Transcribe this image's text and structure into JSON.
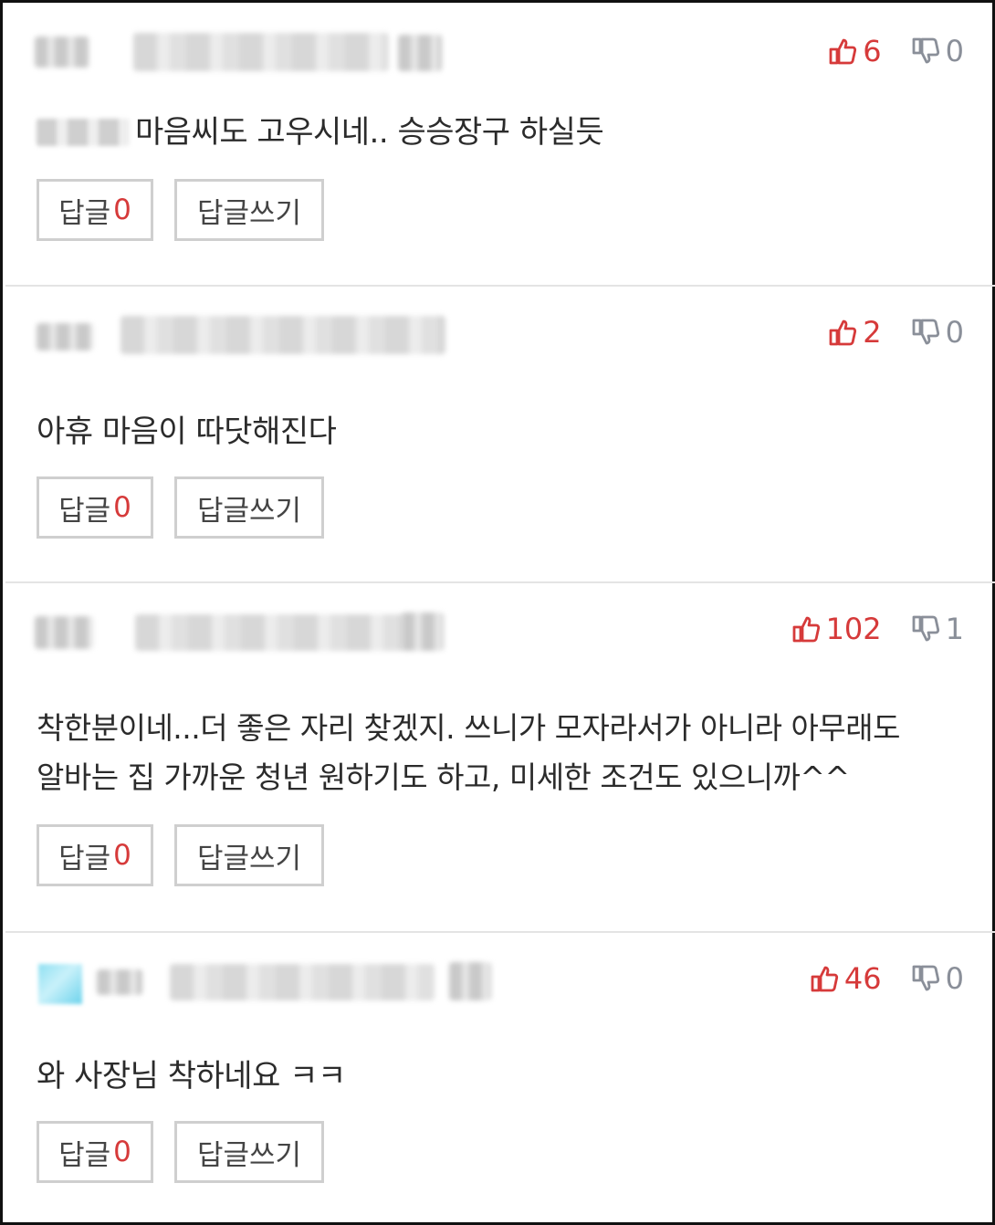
{
  "comments": [
    {
      "text": "마음씨도 고우시네.. 승승장구 하실듯",
      "likes": "6",
      "dislikes": "0",
      "reply_label": "답글",
      "reply_count": "0",
      "write_label": "답글쓰기"
    },
    {
      "text": "아휴 마음이 따닷해진다",
      "likes": "2",
      "dislikes": "0",
      "reply_label": "답글",
      "reply_count": "0",
      "write_label": "답글쓰기"
    },
    {
      "text_line1": "착한분이네...더 좋은 자리 찾겠지. 쓰니가 모자라서가 아니라 아무래도",
      "text_line2": "알바는 집 가까운 청년 원하기도 하고, 미세한 조건도 있으니까^^",
      "likes": "102",
      "dislikes": "1",
      "reply_label": "답글",
      "reply_count": "0",
      "write_label": "답글쓰기"
    },
    {
      "text": "와 사장님 착하네요 ㅋㅋ",
      "likes": "46",
      "dislikes": "0",
      "reply_label": "답글",
      "reply_count": "0",
      "write_label": "답글쓰기"
    }
  ],
  "icons": {
    "like": "thumbs-up-icon",
    "dislike": "thumbs-down-icon"
  },
  "colors": {
    "like": "#d63a3a",
    "dislike": "#8a8f99",
    "reply_count": "#d63a3a",
    "border": "#cfcfcf"
  }
}
